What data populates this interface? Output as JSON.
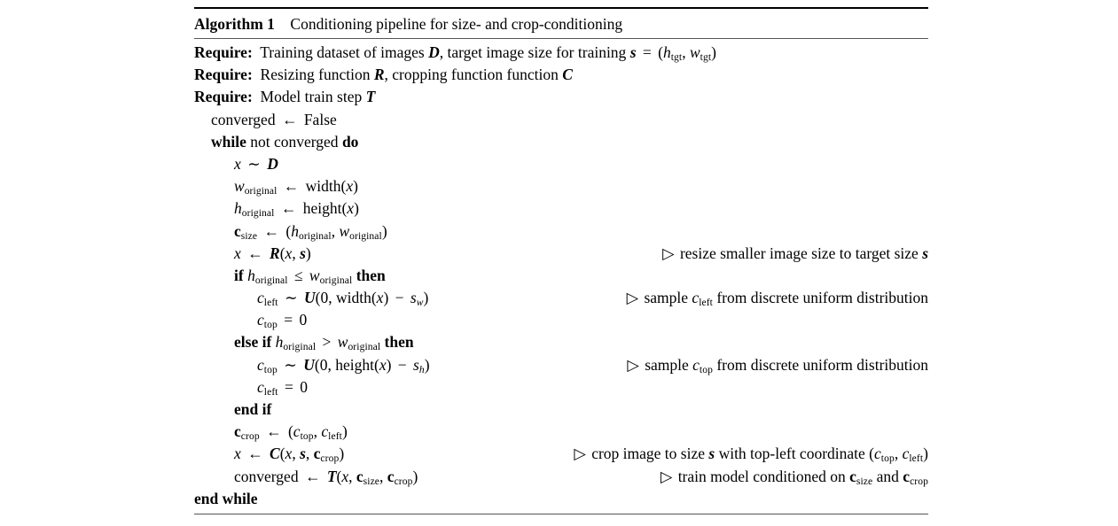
{
  "algorithm": {
    "caption_label": "Algorithm 1",
    "caption_title": "Conditioning pipeline for size- and crop-conditioning",
    "require_keyword": "Require:",
    "lines": [
      {
        "id": "require-1",
        "indent": 0,
        "code_text": "Require: Training dataset of images D, target image size for training s = (h_tgt, w_tgt)",
        "comment_text": ""
      },
      {
        "id": "require-2",
        "indent": 0,
        "code_text": "Require: Resizing function R, cropping function function C",
        "comment_text": ""
      },
      {
        "id": "require-3",
        "indent": 0,
        "code_text": "Require: Model train step T",
        "comment_text": ""
      },
      {
        "id": "converged-init",
        "indent": 1,
        "code_text": "converged ← False",
        "comment_text": ""
      },
      {
        "id": "while-start",
        "indent": 1,
        "code_text": "while not converged do",
        "comment_text": ""
      },
      {
        "id": "sample-x",
        "indent": 2,
        "code_text": "x ~ D",
        "comment_text": ""
      },
      {
        "id": "w-original",
        "indent": 2,
        "code_text": "w_original ← width(x)",
        "comment_text": ""
      },
      {
        "id": "h-original",
        "indent": 2,
        "code_text": "h_original ← height(x)",
        "comment_text": ""
      },
      {
        "id": "c-size",
        "indent": 2,
        "code_text": "c_size ← (h_original, w_original)",
        "comment_text": ""
      },
      {
        "id": "resize-x",
        "indent": 2,
        "code_text": "x ← R(x, s)",
        "comment_text": "▷ resize smaller image size to target size s"
      },
      {
        "id": "if-landscape",
        "indent": 2,
        "code_text": "if h_original ≤ w_original then",
        "comment_text": ""
      },
      {
        "id": "c-left-sample",
        "indent": 3,
        "code_text": "c_left ~ U(0, width(x) − s_w)",
        "comment_text": "▷ sample c_left from discrete uniform distribution"
      },
      {
        "id": "c-top-zero",
        "indent": 3,
        "code_text": "c_top = 0",
        "comment_text": ""
      },
      {
        "id": "else-if-portrait",
        "indent": 2,
        "code_text": "else if h_original > w_original then",
        "comment_text": ""
      },
      {
        "id": "c-top-sample",
        "indent": 3,
        "code_text": "c_top ~ U(0, height(x) − s_h)",
        "comment_text": "▷ sample c_top from discrete uniform distribution"
      },
      {
        "id": "c-left-zero",
        "indent": 3,
        "code_text": "c_left = 0",
        "comment_text": ""
      },
      {
        "id": "end-if",
        "indent": 2,
        "code_text": "end if",
        "comment_text": ""
      },
      {
        "id": "c-crop",
        "indent": 2,
        "code_text": "c_crop ← (c_top, c_left)",
        "comment_text": ""
      },
      {
        "id": "crop-x",
        "indent": 2,
        "code_text": "x ← C(x, s, c_crop)",
        "comment_text": "▷ crop image to size s with top-left coordinate (c_top, c_left)"
      },
      {
        "id": "train-step",
        "indent": 2,
        "code_text": "converged ← T(x, c_size, c_crop)",
        "comment_text": "▷ train model conditioned on c_size and c_crop"
      },
      {
        "id": "end-while",
        "indent": 1,
        "code_text": "end while",
        "comment_text": ""
      }
    ]
  }
}
